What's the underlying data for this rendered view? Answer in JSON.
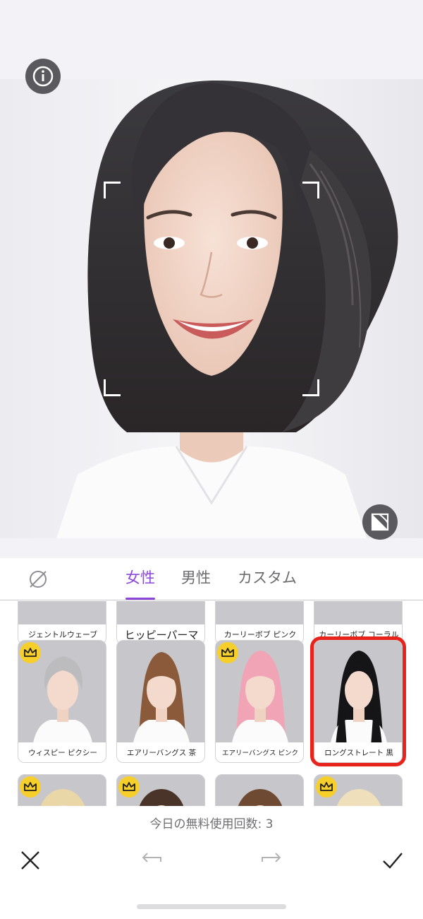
{
  "categories": {
    "tabs": [
      {
        "label": "女性",
        "active": true
      },
      {
        "label": "男性",
        "active": false
      },
      {
        "label": "カスタム",
        "active": false
      }
    ]
  },
  "styles_row_prev": [
    {
      "label": "ジェントルウェーブ"
    },
    {
      "label": "ヒッピーパーマ"
    },
    {
      "label": "カーリーボブ ピンク"
    },
    {
      "label": "カーリーボブ コーラル"
    }
  ],
  "styles_row_main": [
    {
      "label": "ウィスピー ピクシー",
      "premium": true,
      "hair_color": "#bcbcbf"
    },
    {
      "label": "エアリーバングス 茶",
      "premium": false,
      "hair_color": "#8a5a3a"
    },
    {
      "label": "エアリーバングス ピンク",
      "premium": true,
      "hair_color": "#f0a4b6"
    },
    {
      "label": "ロングストレート 黒",
      "premium": false,
      "hair_color": "#151518",
      "selected": true
    }
  ],
  "styles_row_next": [
    {
      "premium": true,
      "hair_color": "#e9d7a8"
    },
    {
      "premium": true,
      "hair_color": "#4a3328"
    },
    {
      "premium": false,
      "hair_color": "#6e4a33"
    },
    {
      "premium": true,
      "hair_color": "#efe0bb"
    }
  ],
  "usage": {
    "text": "今日の無料使用回数: 3"
  },
  "colors": {
    "accent": "#8c47d9",
    "selection": "#e8231b",
    "crown": "#f7cf2a"
  },
  "icons": {
    "info": "info-icon",
    "compare": "compare-icon",
    "none": "no-style-icon",
    "cancel": "close-icon",
    "undo": "undo-arrow-icon",
    "redo": "redo-arrow-icon",
    "confirm": "checkmark-icon"
  }
}
